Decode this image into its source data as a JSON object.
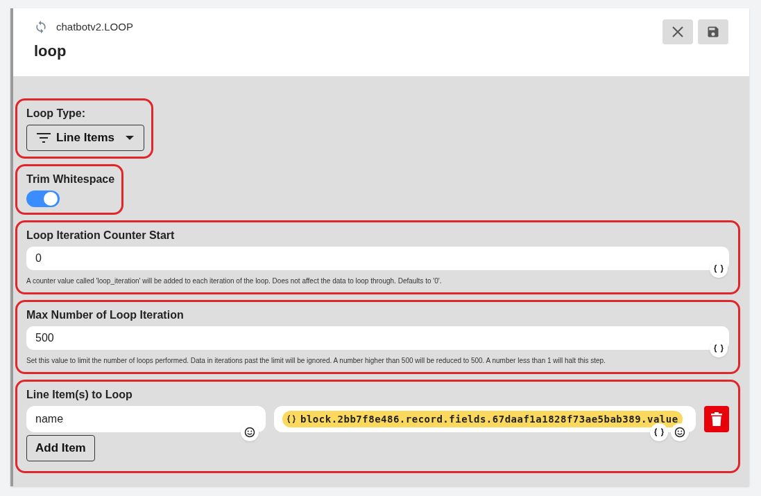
{
  "header": {
    "breadcrumb": "chatbotv2.LOOP",
    "title": "loop"
  },
  "sections": [
    {
      "kind": "dropdown",
      "label": "Loop Type:",
      "value": "Line Items"
    },
    {
      "kind": "toggle",
      "label": "Trim Whitespace",
      "on": true
    },
    {
      "kind": "text",
      "label": "Loop Iteration Counter Start",
      "value": "0",
      "help": "A counter value called 'loop_iteration' will be added to each iteration of the loop. Does not affect the data to loop through. Defaults to '0'."
    },
    {
      "kind": "text",
      "label": "Max Number of Loop Iteration",
      "value": "500",
      "help": "Set this value to limit the number of loops performed. Data in iterations past the limit will be ignored. A number higher than 500 will be reduced to 500. A number less than 1 will halt this step."
    },
    {
      "kind": "list",
      "label": "Line Item(s) to Loop",
      "items": [
        {
          "name": "name",
          "value": "block.2bb7f8e486.record.fields.67daaf1a1828f73ae5bab389.value"
        }
      ],
      "add_button": "Add Item"
    }
  ]
}
